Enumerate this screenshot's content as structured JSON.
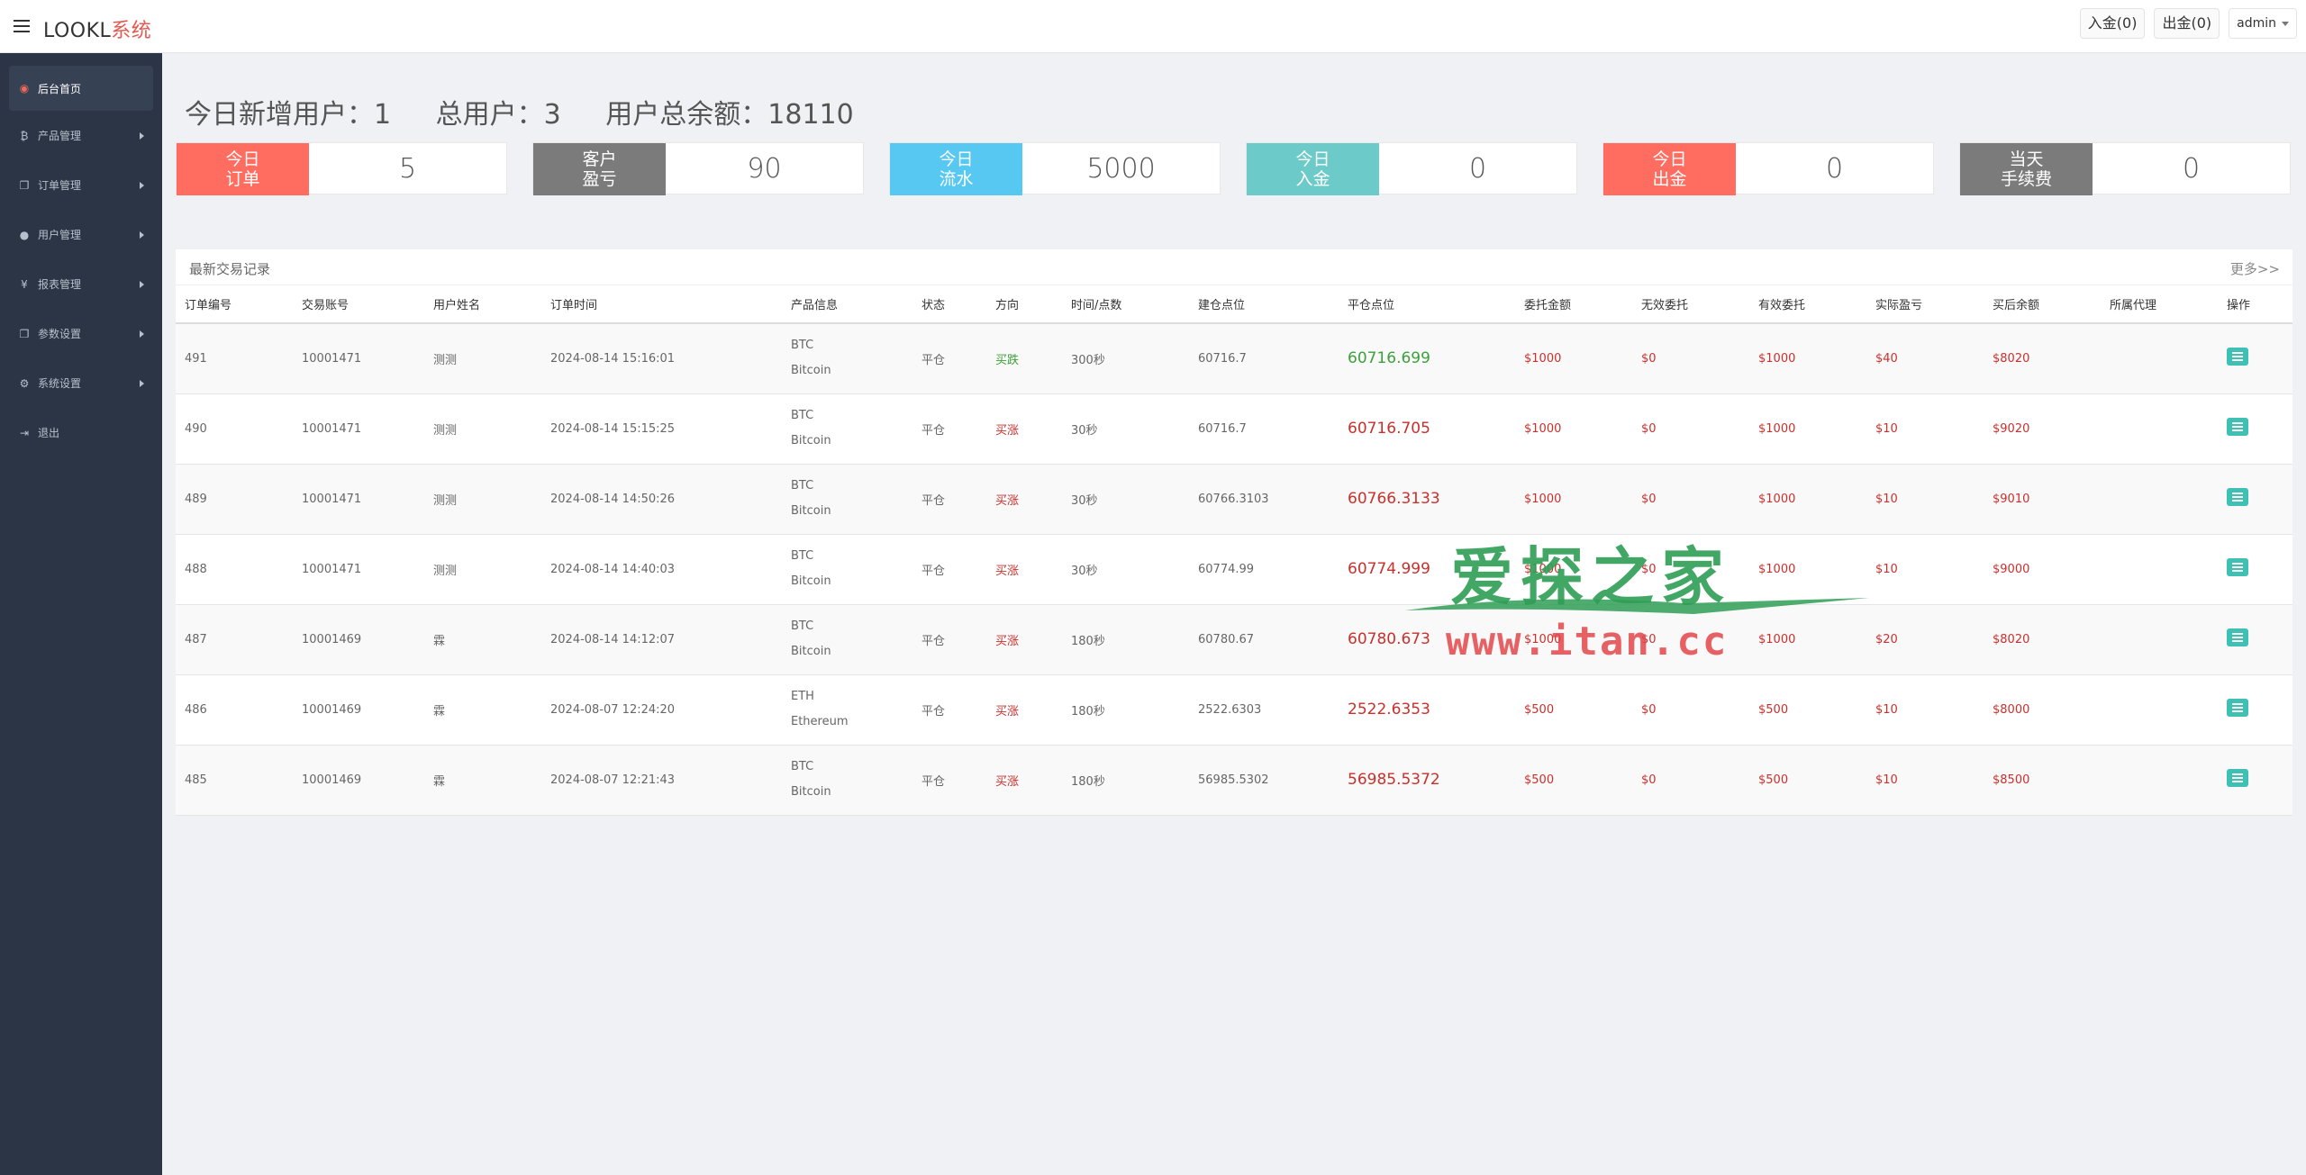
{
  "app": {
    "logo_main": "LOOKL",
    "logo_accent": "系统"
  },
  "topbar": {
    "deposit": "入金(0)",
    "withdraw": "出金(0)",
    "user": "admin"
  },
  "sidebar": {
    "items": [
      {
        "label": "后台首页",
        "icon": "dashboard-icon"
      },
      {
        "label": "产品管理",
        "icon": "bitcoin-icon"
      },
      {
        "label": "订单管理",
        "icon": "copy-icon"
      },
      {
        "label": "用户管理",
        "icon": "user-icon"
      },
      {
        "label": "报表管理",
        "icon": "yen-icon"
      },
      {
        "label": "参数设置",
        "icon": "copy-icon"
      },
      {
        "label": "系统设置",
        "icon": "gears-icon"
      },
      {
        "label": "退出",
        "icon": "sign-out-icon"
      }
    ]
  },
  "stats": {
    "new_users": "今日新增用户：1",
    "total_users": "总用户：3",
    "total_balance": "用户总余额：18110"
  },
  "cards": [
    {
      "line1": "今日",
      "line2": "订单",
      "value": "5",
      "color": "#ff6c60"
    },
    {
      "line1": "客户",
      "line2": "盈亏",
      "value": "90",
      "color": "#7b7b7b"
    },
    {
      "line1": "今日",
      "line2": "流水",
      "value": "5000",
      "color": "#57c8f2"
    },
    {
      "line1": "今日",
      "line2": "入金",
      "value": "0",
      "color": "#6ccac9"
    },
    {
      "line1": "今日",
      "line2": "出金",
      "value": "0",
      "color": "#ff6c60"
    },
    {
      "line1": "当天",
      "line2": "手续费",
      "value": "0",
      "color": "#7b7b7b"
    }
  ],
  "panel": {
    "title": "最新交易记录",
    "more": "更多>>",
    "headers": [
      "订单编号",
      "交易账号",
      "用户姓名",
      "订单时间",
      "产品信息",
      "状态",
      "方向",
      "时间/点数",
      "建仓点位",
      "平仓点位",
      "委托金额",
      "无效委托",
      "有效委托",
      "实际盈亏",
      "买后余额",
      "所属代理",
      "操作"
    ],
    "rows": [
      {
        "id": "491",
        "account": "10001471",
        "name": "测测",
        "time": "2024-08-14 15:16:01",
        "prod_code": "BTC",
        "prod_name": "Bitcoin",
        "status": "平仓",
        "direction": "买跌",
        "dir_color": "green",
        "duration": "300秒",
        "open": "60716.7",
        "close": "60716.699",
        "close_color": "green",
        "amount": "$1000",
        "invalid": "$0",
        "valid": "$1000",
        "pnl": "$40",
        "balance": "$8020",
        "agent": ""
      },
      {
        "id": "490",
        "account": "10001471",
        "name": "测测",
        "time": "2024-08-14 15:15:25",
        "prod_code": "BTC",
        "prod_name": "Bitcoin",
        "status": "平仓",
        "direction": "买涨",
        "dir_color": "red",
        "duration": "30秒",
        "open": "60716.7",
        "close": "60716.705",
        "close_color": "red",
        "amount": "$1000",
        "invalid": "$0",
        "valid": "$1000",
        "pnl": "$10",
        "balance": "$9020",
        "agent": ""
      },
      {
        "id": "489",
        "account": "10001471",
        "name": "测测",
        "time": "2024-08-14 14:50:26",
        "prod_code": "BTC",
        "prod_name": "Bitcoin",
        "status": "平仓",
        "direction": "买涨",
        "dir_color": "red",
        "duration": "30秒",
        "open": "60766.3103",
        "close": "60766.3133",
        "close_color": "red",
        "amount": "$1000",
        "invalid": "$0",
        "valid": "$1000",
        "pnl": "$10",
        "balance": "$9010",
        "agent": ""
      },
      {
        "id": "488",
        "account": "10001471",
        "name": "测测",
        "time": "2024-08-14 14:40:03",
        "prod_code": "BTC",
        "prod_name": "Bitcoin",
        "status": "平仓",
        "direction": "买涨",
        "dir_color": "red",
        "duration": "30秒",
        "open": "60774.99",
        "close": "60774.999",
        "close_color": "red",
        "amount": "$1000",
        "invalid": "$0",
        "valid": "$1000",
        "pnl": "$10",
        "balance": "$9000",
        "agent": ""
      },
      {
        "id": "487",
        "account": "10001469",
        "name": "霖",
        "time": "2024-08-14 14:12:07",
        "prod_code": "BTC",
        "prod_name": "Bitcoin",
        "status": "平仓",
        "direction": "买涨",
        "dir_color": "red",
        "duration": "180秒",
        "open": "60780.67",
        "close": "60780.673",
        "close_color": "red",
        "amount": "$1000",
        "invalid": "$0",
        "valid": "$1000",
        "pnl": "$20",
        "balance": "$8020",
        "agent": ""
      },
      {
        "id": "486",
        "account": "10001469",
        "name": "霖",
        "time": "2024-08-07 12:24:20",
        "prod_code": "ETH",
        "prod_name": "Ethereum",
        "status": "平仓",
        "direction": "买涨",
        "dir_color": "red",
        "duration": "180秒",
        "open": "2522.6303",
        "close": "2522.6353",
        "close_color": "red",
        "amount": "$500",
        "invalid": "$0",
        "valid": "$500",
        "pnl": "$10",
        "balance": "$8000",
        "agent": ""
      },
      {
        "id": "485",
        "account": "10001469",
        "name": "霖",
        "time": "2024-08-07 12:21:43",
        "prod_code": "BTC",
        "prod_name": "Bitcoin",
        "status": "平仓",
        "direction": "买涨",
        "dir_color": "red",
        "duration": "180秒",
        "open": "56985.5302",
        "close": "56985.5372",
        "close_color": "red",
        "amount": "$500",
        "invalid": "$0",
        "valid": "$500",
        "pnl": "$10",
        "balance": "$8500",
        "agent": ""
      }
    ]
  },
  "watermark": {
    "title": "爱探之家",
    "url": "www.itan.cc"
  }
}
